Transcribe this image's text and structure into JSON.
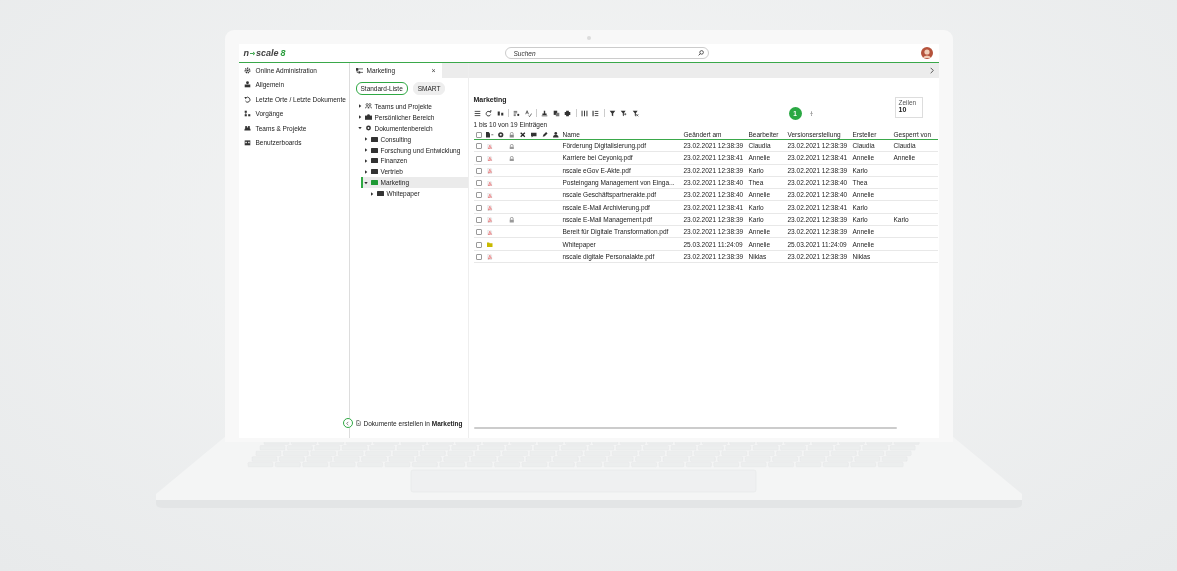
{
  "top_bar": {
    "logo": {
      "prefix": "n",
      "name": "scale",
      "mark": "8"
    },
    "search": {
      "placeholder": "Suchen"
    }
  },
  "sidebar": {
    "items": [
      {
        "label": "Online Administration",
        "selected": false
      },
      {
        "label": "Allgemein",
        "selected": false
      },
      {
        "label": "Letzte Orte / Letzte Dokumente",
        "selected": false
      },
      {
        "label": "Vorgänge",
        "selected": false
      },
      {
        "label": "Teams & Projekte",
        "selected": false
      },
      {
        "label": "Benutzerboards",
        "selected": false
      }
    ]
  },
  "tab": {
    "title": "Marketing",
    "close": "×"
  },
  "views": [
    {
      "label": "Standard-Liste",
      "selected": true
    },
    {
      "label": "SMART",
      "selected": false
    }
  ],
  "tree": [
    {
      "label": "Teams und Projekte",
      "kind": "teams",
      "expanded": false,
      "selected": false
    },
    {
      "label": "Persönlicher Bereich",
      "kind": "personal",
      "expanded": false,
      "selected": false
    },
    {
      "label": "Dokumentenbereich",
      "kind": "area",
      "expanded": true,
      "selected": false,
      "children": [
        {
          "label": "Consulting",
          "kind": "folder",
          "expanded": false,
          "selected": false
        },
        {
          "label": "Forschung und Entwicklung",
          "kind": "folder",
          "expanded": false,
          "selected": false
        },
        {
          "label": "Finanzen",
          "kind": "folder",
          "expanded": false,
          "selected": false
        },
        {
          "label": "Vertrieb",
          "kind": "folder",
          "expanded": false,
          "selected": false
        },
        {
          "label": "Marketing",
          "kind": "folder",
          "expanded": true,
          "selected": true,
          "children": [
            {
              "label": "Whitepaper",
              "kind": "folder",
              "expanded": false,
              "selected": false
            }
          ]
        }
      ]
    }
  ],
  "footer": {
    "text": "Dokumente erstellen in **Marketing**"
  },
  "main": {
    "title": "Marketing",
    "pages": [
      {
        "label": "1",
        "selected": true
      }
    ],
    "rows_field": {
      "label": "Zeilen",
      "value": "10"
    },
    "info": "1 bis 10 von 19 Einträgen"
  },
  "table": {
    "select_all": {
      "checked": false
    },
    "columns": [
      "Name",
      "Geändert am",
      "Bearbeiter",
      "Versionserstellung",
      "Ersteller",
      "Gesperrt von"
    ],
    "rows": [
      {
        "kind": "pdf",
        "checked": false,
        "locked": true,
        "cells": [
          "Förderung Digitalisierung.pdf",
          "23.02.2021 12:38:39",
          "Claudia",
          "23.02.2021 12:38:39",
          "Claudia",
          "Claudia"
        ]
      },
      {
        "kind": "pdf",
        "checked": false,
        "locked": true,
        "cells": [
          "Karriere bei Ceyoniq.pdf",
          "23.02.2021 12:38:41",
          "Annelie",
          "23.02.2021 12:38:41",
          "Annelie",
          "Annelie"
        ]
      },
      {
        "kind": "pdf",
        "checked": false,
        "locked": false,
        "cells": [
          "nscale eGov E-Akte.pdf",
          "23.02.2021 12:38:39",
          "Karlo",
          "23.02.2021 12:38:39",
          "Karlo"
        ]
      },
      {
        "kind": "pdf",
        "checked": false,
        "locked": false,
        "cells": [
          "Posteingang Management von Einga...",
          "23.02.2021 12:38:40",
          "Thea",
          "23.02.2021 12:38:40",
          "Thea"
        ]
      },
      {
        "kind": "pdf",
        "checked": false,
        "locked": false,
        "cells": [
          "nscale Geschäftspartnerakte.pdf",
          "23.02.2021 12:38:40",
          "Annelie",
          "23.02.2021 12:38:40",
          "Annelie"
        ]
      },
      {
        "kind": "pdf",
        "checked": false,
        "locked": false,
        "cells": [
          "nscale E-Mail Archivierung.pdf",
          "23.02.2021 12:38:41",
          "Karlo",
          "23.02.2021 12:38:41",
          "Karlo"
        ]
      },
      {
        "kind": "pdf",
        "checked": false,
        "locked": true,
        "cells": [
          "nscale E-Mail Management.pdf",
          "23.02.2021 12:38:39",
          "Karlo",
          "23.02.2021 12:38:39",
          "Karlo",
          "Karlo"
        ]
      },
      {
        "kind": "pdf",
        "checked": false,
        "locked": false,
        "cells": [
          "Bereit für Digitale Transformation.pdf",
          "23.02.2021 12:38:39",
          "Annelie",
          "23.02.2021 12:38:39",
          "Annelie"
        ]
      },
      {
        "kind": "folder",
        "checked": false,
        "locked": false,
        "cells": [
          "Whitepaper",
          "25.03.2021 11:24:09",
          "Annelie",
          "25.03.2021 11:24:09",
          "Annelie"
        ]
      },
      {
        "kind": "pdf",
        "checked": false,
        "locked": false,
        "cells": [
          "nscale digitale Personalakte.pdf",
          "23.02.2021 12:38:39",
          "Niklas",
          "23.02.2021 12:38:39",
          "Niklas"
        ]
      }
    ]
  }
}
